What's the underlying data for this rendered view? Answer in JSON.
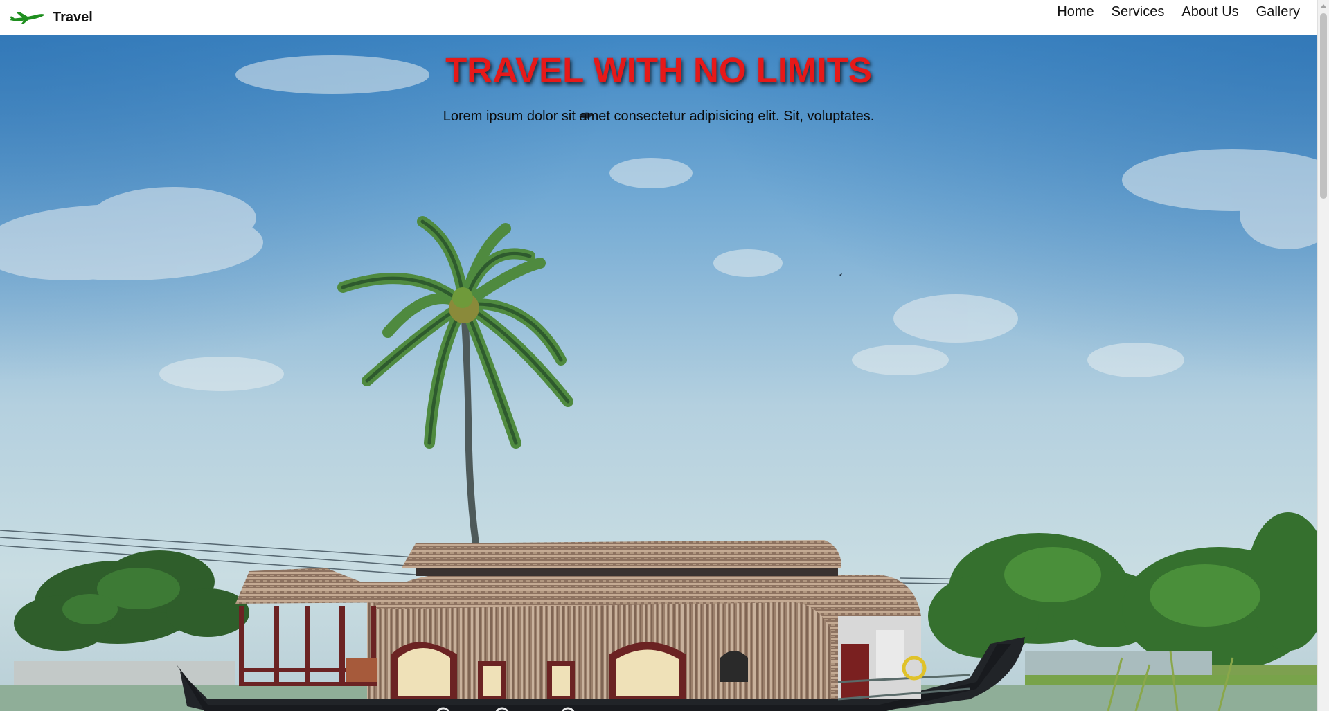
{
  "brand": {
    "name": "Travel",
    "icon": "airplane-icon",
    "icon_color": "#1f8f1f"
  },
  "nav": {
    "items": [
      {
        "label": "Home"
      },
      {
        "label": "Services"
      },
      {
        "label": "About Us"
      },
      {
        "label": "Gallery"
      }
    ]
  },
  "hero": {
    "title": "TRAVEL WITH NO LIMITS",
    "subtitle": "Lorem ipsum dolor sit amet consectetur adipisicing elit. Sit, voluptates.",
    "title_color": "#e61919",
    "background_image": "houseboat-palm-scene"
  }
}
